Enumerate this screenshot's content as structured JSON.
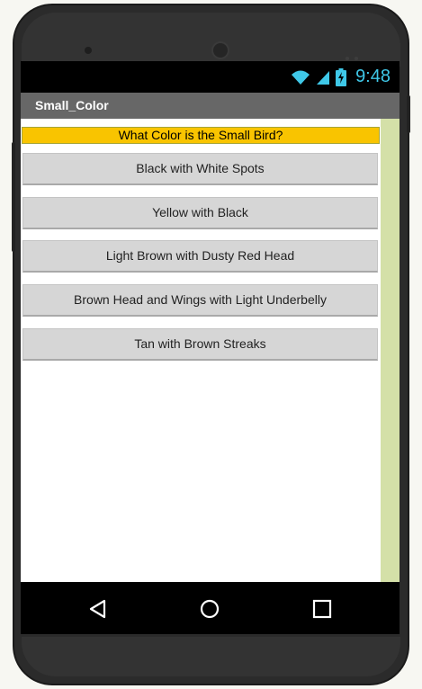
{
  "status_bar": {
    "time": "9:48",
    "icon_color": "#3fc8e8",
    "icons": [
      "wifi-icon",
      "signal-icon",
      "battery-charging-icon"
    ]
  },
  "app": {
    "title": "Small_Color"
  },
  "question": {
    "text": "What Color is the Small Bird?",
    "background": "#f9c400"
  },
  "answers": [
    {
      "label": "Black with White Spots"
    },
    {
      "label": "Yellow with Black"
    },
    {
      "label": "Light Brown with Dusty Red Head"
    },
    {
      "label": "Brown Head and Wings with Light Underbelly"
    },
    {
      "label": "Tan with Brown Streaks"
    }
  ],
  "nav_bar": {
    "icons": [
      "back-icon",
      "home-icon",
      "recent-apps-icon"
    ]
  }
}
